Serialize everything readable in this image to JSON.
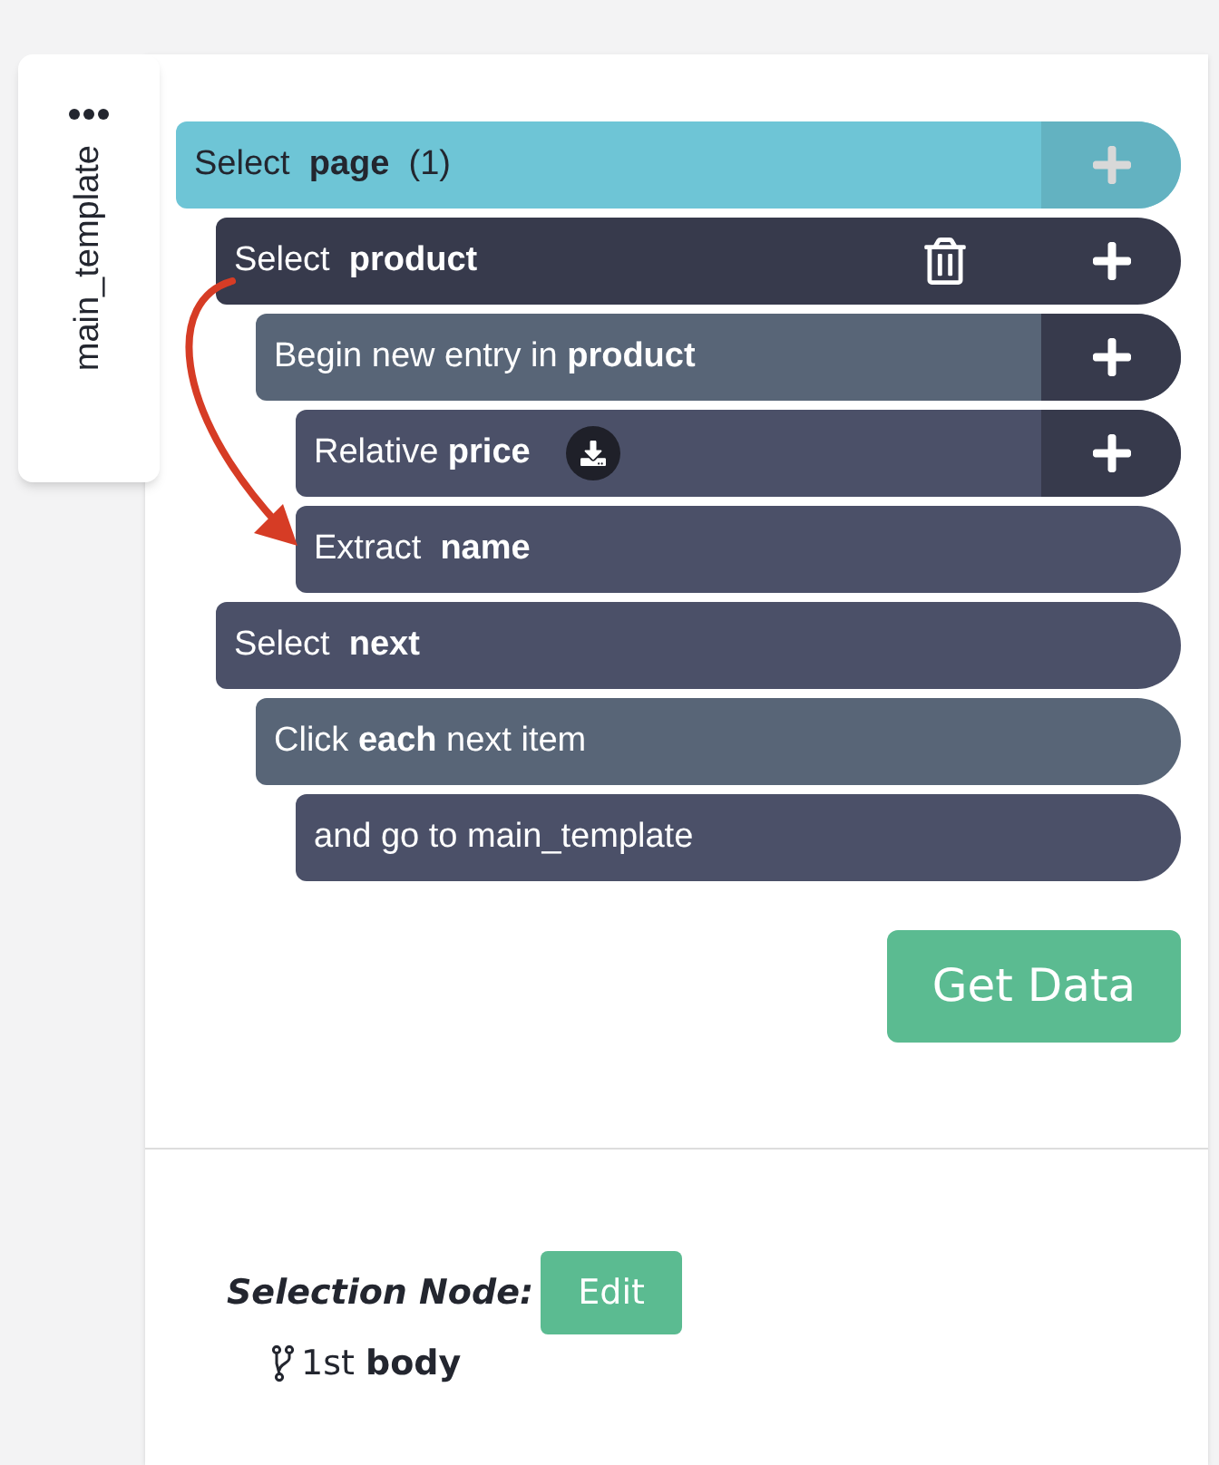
{
  "sidebar_tab": {
    "label": "main_template"
  },
  "steps": [
    {
      "kind": "page",
      "text": "Select  **page**  (1)",
      "selected": false,
      "add": true,
      "add_disabled": true,
      "children": [
        {
          "kind": "select",
          "text": "Select  **product**",
          "selected": true,
          "add": true,
          "add_disabled": false,
          "children": [
            {
              "kind": "entry",
              "text": "Begin new entry in **product**",
              "selected": false,
              "add": true,
              "add_disabled": false,
              "children": [
                {
                  "kind": "field",
                  "text": "Relative **price**",
                  "selected": false,
                  "add": true,
                  "add_disabled": false,
                  "download": true
                },
                {
                  "kind": "field",
                  "text": "Extract  **name**",
                  "selected": false
                }
              ]
            }
          ]
        },
        {
          "kind": "select",
          "text": "Select  **next**",
          "selected": false,
          "children": [
            {
              "kind": "entry",
              "text": "Click **each** next item",
              "selected": false,
              "children": [
                {
                  "kind": "field",
                  "text": "and go to main_template",
                  "selected": false
                }
              ]
            }
          ]
        }
      ]
    }
  ],
  "get_data_button": "Get Data",
  "selection_node": {
    "label": "Selection Node:",
    "edit_button": "Edit",
    "path": "1st **body**"
  }
}
